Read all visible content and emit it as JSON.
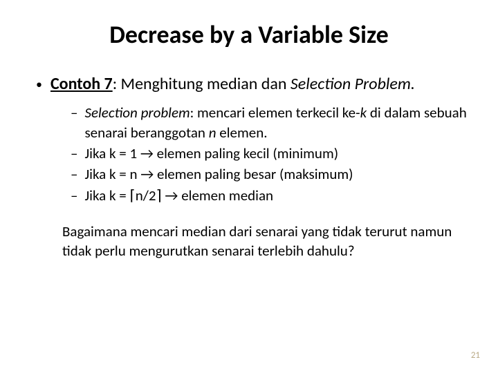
{
  "title": "Decrease by a Variable Size",
  "main": {
    "label": "Contoh 7",
    "sep": ":  ",
    "body1": "Menghitung median dan ",
    "body2_ital": "Selection Problem.",
    "bullet": "•"
  },
  "sub": {
    "dash": "–",
    "items": [
      {
        "lead_ital": "Selection problem",
        "rest": ": mencari elemen terkecil ke-",
        "k": "k",
        "rest2": " di dalam sebuah senarai beranggotan ",
        "n": "n",
        "rest3": " elemen."
      },
      {
        "plain": "Jika k = 1 → elemen paling kecil (minimum)"
      },
      {
        "plain": "Jika k = n → elemen paling besar (maksimum)"
      },
      {
        "pre": "Jika k = ",
        "ceil_l": "⌈",
        "mid": "n/2",
        "ceil_r": "⌉",
        "post": " → elemen median"
      }
    ]
  },
  "closing": "Bagaimana mencari median dari senarai yang tidak terurut namun tidak perlu mengurutkan senarai terlebih dahulu?",
  "page": "21"
}
